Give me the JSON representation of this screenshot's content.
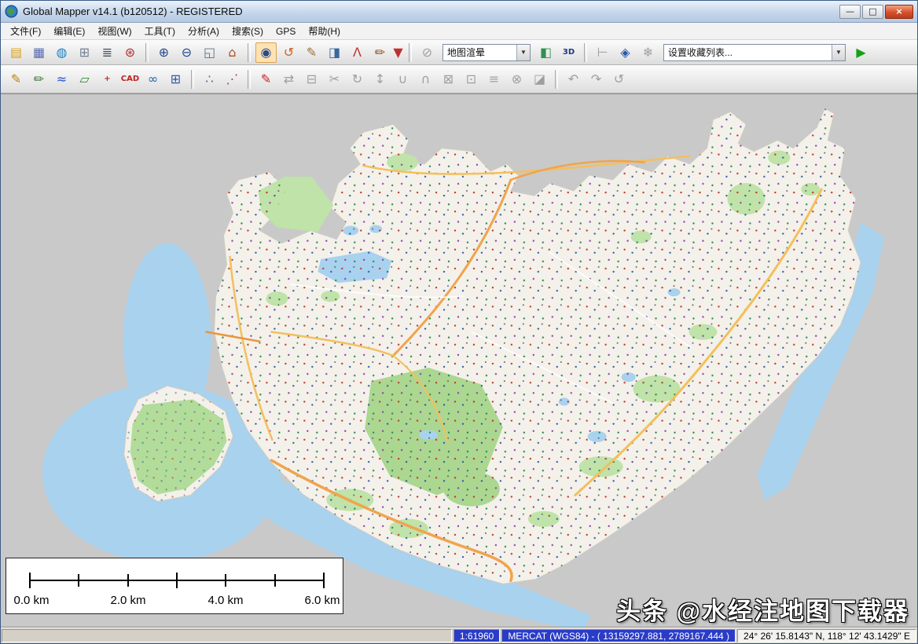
{
  "window": {
    "title": "Global Mapper v14.1 (b120512) - REGISTERED",
    "controls": {
      "minimize": "—",
      "maximize": "□",
      "close": "×"
    }
  },
  "menu": {
    "items": [
      {
        "label": "文件(F)",
        "key": "file"
      },
      {
        "label": "编辑(E)",
        "key": "edit"
      },
      {
        "label": "视图(W)",
        "key": "view"
      },
      {
        "label": "工具(T)",
        "key": "tools"
      },
      {
        "label": "分析(A)",
        "key": "analysis"
      },
      {
        "label": "搜索(S)",
        "key": "search"
      },
      {
        "label": "GPS",
        "key": "gps"
      },
      {
        "label": "帮助(H)",
        "key": "help"
      }
    ]
  },
  "toolbar1": {
    "shader_value": "地图渲晕",
    "favorites_value": "设置收藏列表...",
    "items": [
      {
        "type": "btn",
        "name": "open-file",
        "glyph": "▤",
        "color": "#d8a020"
      },
      {
        "type": "btn",
        "name": "save-workspace",
        "glyph": "▦",
        "color": "#5868b0"
      },
      {
        "type": "btn",
        "name": "online-data",
        "glyph": "◍",
        "color": "#2080c0"
      },
      {
        "type": "btn",
        "name": "open-data-file",
        "glyph": "⊞",
        "color": "#708090"
      },
      {
        "type": "btn",
        "name": "overlay-control-center",
        "glyph": "≣",
        "color": "#405060"
      },
      {
        "type": "btn",
        "name": "configuration",
        "glyph": "⊛",
        "color": "#b03030"
      },
      {
        "type": "sep"
      },
      {
        "type": "btn",
        "name": "zoom-in",
        "glyph": "⊕",
        "color": "#204888"
      },
      {
        "type": "btn",
        "name": "zoom-out",
        "glyph": "⊖",
        "color": "#204888"
      },
      {
        "type": "btn",
        "name": "zoom-window",
        "glyph": "◱",
        "color": "#607080"
      },
      {
        "type": "btn",
        "name": "full-extent",
        "glyph": "⌂",
        "color": "#b05028"
      },
      {
        "type": "sep"
      },
      {
        "type": "btn",
        "name": "zoom-tool",
        "glyph": "◉",
        "color": "#2a4a8a",
        "active": true
      },
      {
        "type": "btn",
        "name": "pan-tool",
        "glyph": "↺",
        "color": "#d06020"
      },
      {
        "type": "btn",
        "name": "measure-tool",
        "glyph": "✎",
        "color": "#a07030"
      },
      {
        "type": "btn",
        "name": "feature-info-tool",
        "glyph": "◨",
        "color": "#3868a0"
      },
      {
        "type": "btn",
        "name": "path-profile-tool",
        "glyph": "Λ",
        "color": "#c03030"
      },
      {
        "type": "btn",
        "name": "digitizer-tool",
        "glyph": "✏",
        "color": "#905020"
      },
      {
        "type": "btn",
        "name": "more-tools-dropdown",
        "glyph": "▼",
        "color": "#c03030",
        "narrow": true
      },
      {
        "type": "sep"
      },
      {
        "type": "btn",
        "name": "gps-tracking",
        "glyph": "⊘",
        "color": "#888888",
        "disabled": true
      },
      {
        "type": "combo",
        "name": "shader-combo",
        "bind": "shader_value",
        "cls": "shader"
      },
      {
        "type": "btn",
        "name": "shader-options",
        "glyph": "◧",
        "color": "#309050"
      },
      {
        "type": "btn",
        "name": "view-3d",
        "glyph": "3D",
        "color": "#203880",
        "text": true
      },
      {
        "type": "sep"
      },
      {
        "type": "btn",
        "name": "terrain-profile",
        "glyph": "⊢",
        "color": "#888888",
        "disabled": true
      },
      {
        "type": "btn",
        "name": "fly-through",
        "glyph": "◈",
        "color": "#2858a8"
      },
      {
        "type": "btn",
        "name": "freeze-display",
        "glyph": "❄",
        "color": "#888888",
        "disabled": true
      },
      {
        "type": "combo",
        "name": "favorites-combo",
        "bind": "favorites_value",
        "cls": "favorites"
      },
      {
        "type": "btn",
        "name": "apply-favorite",
        "glyph": "▶",
        "color": "#18a018"
      }
    ]
  },
  "toolbar2": {
    "items": [
      {
        "type": "btn",
        "name": "digitizer-select",
        "glyph": "✎",
        "color": "#b8860b"
      },
      {
        "type": "btn",
        "name": "edit-vertices",
        "glyph": "✏",
        "color": "#3a7a3a"
      },
      {
        "type": "btn",
        "name": "create-line-feature",
        "glyph": "≈",
        "color": "#2255cc"
      },
      {
        "type": "btn",
        "name": "create-area-feature",
        "glyph": "▱",
        "color": "#3a8a3a"
      },
      {
        "type": "btn",
        "name": "create-point-feature",
        "glyph": "+",
        "color": "#b03030",
        "text": true
      },
      {
        "type": "btn",
        "name": "create-cad-feature",
        "glyph": "CAD",
        "color": "#c02020",
        "text": true
      },
      {
        "type": "btn",
        "name": "create-buffer",
        "glyph": "∞",
        "color": "#2266aa"
      },
      {
        "type": "btn",
        "name": "create-grid",
        "glyph": "⊞",
        "color": "#3355aa"
      },
      {
        "type": "sep"
      },
      {
        "type": "btn",
        "name": "create-points-from-file",
        "glyph": "∴",
        "color": "#884499"
      },
      {
        "type": "btn",
        "name": "create-line-from-vertices",
        "glyph": "⋰",
        "color": "#aa4444"
      },
      {
        "type": "sep"
      },
      {
        "type": "btn",
        "name": "sketch-tool",
        "glyph": "✎",
        "color": "#cc2222"
      },
      {
        "type": "btn",
        "name": "move-feature",
        "glyph": "⇄",
        "color": "#888888",
        "disabled": true
      },
      {
        "type": "btn",
        "name": "copy-feature",
        "glyph": "⊟",
        "color": "#888888",
        "disabled": true
      },
      {
        "type": "btn",
        "name": "cut-feature",
        "glyph": "✂",
        "color": "#888888",
        "disabled": true
      },
      {
        "type": "btn",
        "name": "rotate-feature",
        "glyph": "↻",
        "color": "#888888",
        "disabled": true
      },
      {
        "type": "btn",
        "name": "scale-feature",
        "glyph": "↕",
        "color": "#888888",
        "disabled": true
      },
      {
        "type": "btn",
        "name": "combine-areas",
        "glyph": "∪",
        "color": "#888888",
        "disabled": true
      },
      {
        "type": "btn",
        "name": "intersect-areas",
        "glyph": "∩",
        "color": "#888888",
        "disabled": true
      },
      {
        "type": "btn",
        "name": "crop-areas",
        "glyph": "⊠",
        "color": "#888888",
        "disabled": true
      },
      {
        "type": "btn",
        "name": "snap-vertex",
        "glyph": "⊡",
        "color": "#888888",
        "disabled": true
      },
      {
        "type": "btn",
        "name": "edit-attributes",
        "glyph": "≡",
        "color": "#888888",
        "disabled": true
      },
      {
        "type": "btn",
        "name": "delete-feature",
        "glyph": "⊗",
        "color": "#888888",
        "disabled": true
      },
      {
        "type": "btn",
        "name": "vertex-tools",
        "glyph": "◪",
        "color": "#888888",
        "disabled": true
      },
      {
        "type": "sep"
      },
      {
        "type": "btn",
        "name": "undo-digitize",
        "glyph": "↶",
        "color": "#888888",
        "disabled": true
      },
      {
        "type": "btn",
        "name": "redo-digitize",
        "glyph": "↷",
        "color": "#888888",
        "disabled": true
      },
      {
        "type": "btn",
        "name": "repeat-digitize",
        "glyph": "↺",
        "color": "#888888",
        "disabled": true
      }
    ]
  },
  "map": {
    "watermark": "头条 @水经注地图下载器",
    "scalebar": {
      "labels": [
        "0.0 km",
        "2.0 km",
        "4.0 km",
        "6.0 km"
      ]
    },
    "colors": {
      "background": "#c9c9c9",
      "water": "#a8d2ee",
      "land": "#f4f1ea",
      "park": "#bfe3a8",
      "road_primary": "#f0a44e",
      "road_secondary": "#f3c05c"
    }
  },
  "statusbar": {
    "scale": "1:61960",
    "projection": "MERCAT (WGS84) - ( 13159297.881, 2789167.444 )",
    "position": "24° 26' 15.8143\" N, 118° 12' 43.1429\" E"
  }
}
